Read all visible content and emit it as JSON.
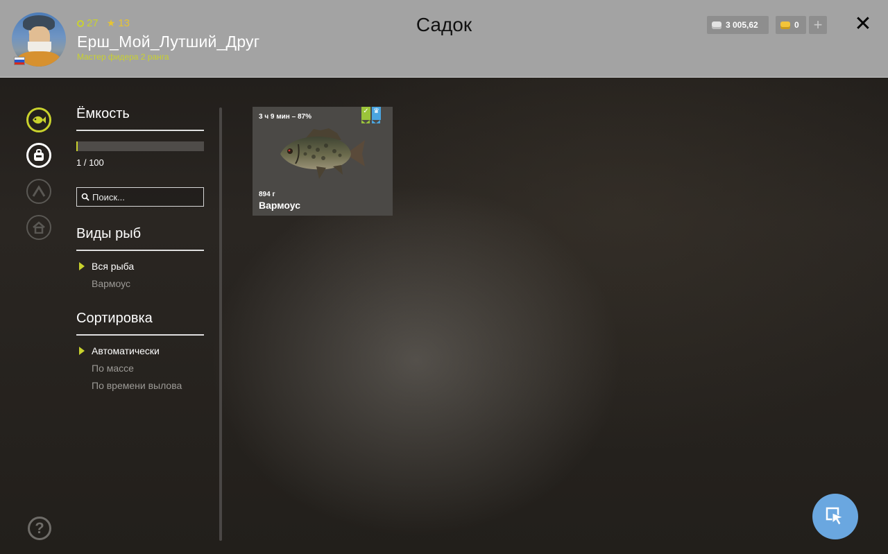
{
  "header": {
    "title": "Садок",
    "player": {
      "level": "27",
      "stars": "13",
      "username": "Ерш_Мой_Лутший_Друг",
      "rank": "Мастер фидера 2 ранга"
    },
    "currency": {
      "silver": "3 005,62",
      "gold": "0"
    },
    "add_label": "+",
    "close_label": "✕"
  },
  "capacity": {
    "heading": "Ёмкость",
    "text": "1 / 100",
    "fill_fraction": 0.01
  },
  "search": {
    "placeholder": "Поиск..."
  },
  "species": {
    "heading": "Виды рыб",
    "options": [
      {
        "label": "Вся рыба",
        "selected": true
      },
      {
        "label": "Вармоус",
        "selected": false
      }
    ]
  },
  "sorting": {
    "heading": "Сортировка",
    "options": [
      {
        "label": "Автоматически",
        "selected": true
      },
      {
        "label": "По массе",
        "selected": false
      },
      {
        "label": "По времени вылова",
        "selected": false
      }
    ]
  },
  "fish_cards": [
    {
      "time": "3 ч 9 мин – 87%",
      "weight": "894 г",
      "name": "Вармоус",
      "badges": [
        "check-icon",
        "crown-icon"
      ]
    }
  ],
  "rail_icons": [
    "fish-icon",
    "inventory-icon",
    "upgrade-icon",
    "home-icon"
  ],
  "help_label": "?",
  "colors": {
    "accent": "#c9d22d",
    "gold": "#e6c432",
    "header_bg": "#a3a3a3",
    "cursor_button": "#6aa7e0"
  }
}
